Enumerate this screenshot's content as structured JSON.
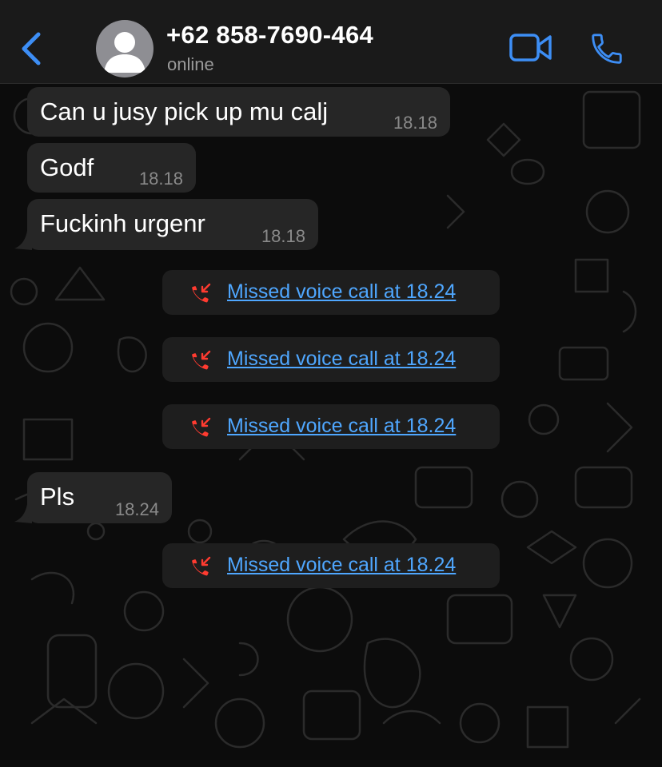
{
  "header": {
    "contact_name": "+62 858-7690-464",
    "status": "online",
    "back_icon": "chevron-left-icon",
    "video_icon": "video-camera-icon",
    "call_icon": "phone-icon"
  },
  "colors": {
    "accent": "#3d8ef5",
    "missed_call": "#ff3b30",
    "link": "#4fa7ff",
    "bubble": "#262626",
    "header_bg": "#1a1a1a"
  },
  "messages": [
    {
      "text": "Can u jusy pick up mu calj",
      "time": "18.18"
    },
    {
      "text": "Godf",
      "time": "18.18"
    },
    {
      "text": "Fuckinh urgenr",
      "time": "18.18"
    },
    {
      "text": "Pls",
      "time": "18.24"
    }
  ],
  "missed_calls": [
    {
      "text": "Missed voice call at 18.24",
      "icon": "missed-call-icon"
    },
    {
      "text": "Missed voice call at 18.24",
      "icon": "missed-call-icon"
    },
    {
      "text": "Missed voice call at 18.24",
      "icon": "missed-call-icon"
    },
    {
      "text": "Missed voice call at 18.24",
      "icon": "missed-call-icon"
    }
  ]
}
